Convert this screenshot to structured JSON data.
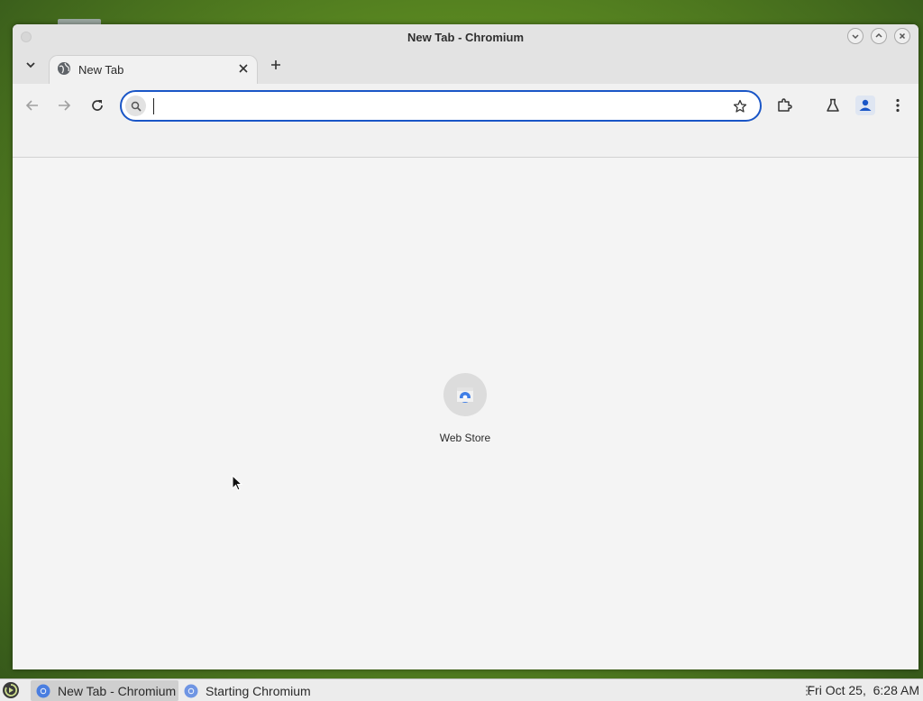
{
  "window": {
    "title": "New Tab - Chromium",
    "controls": [
      "minimize-icon",
      "maximize-icon",
      "close-icon"
    ]
  },
  "tabs": [
    {
      "label": "New Tab",
      "active": true,
      "icon": "globe-icon"
    }
  ],
  "toolbar": {
    "buttons": [
      "back-arrow-icon",
      "forward-arrow-icon",
      "reload-icon",
      "extensions-icon",
      "labs-flask-icon",
      "profile-icon",
      "menu-dots-icon"
    ]
  },
  "omnibox": {
    "value": "",
    "placeholder": "",
    "focused": true,
    "accent": "#1a56c7"
  },
  "shortcuts": [
    {
      "label": "Web Store",
      "icon": "web-store-icon"
    }
  ],
  "taskbar": {
    "items": [
      {
        "label": "New Tab - Chromium",
        "active": true,
        "icon": "chromium-icon"
      },
      {
        "label": "Starting Chromium",
        "active": false,
        "icon": "chromium-icon"
      }
    ],
    "clock": "Fri Oct 25,  6:28 AM"
  }
}
